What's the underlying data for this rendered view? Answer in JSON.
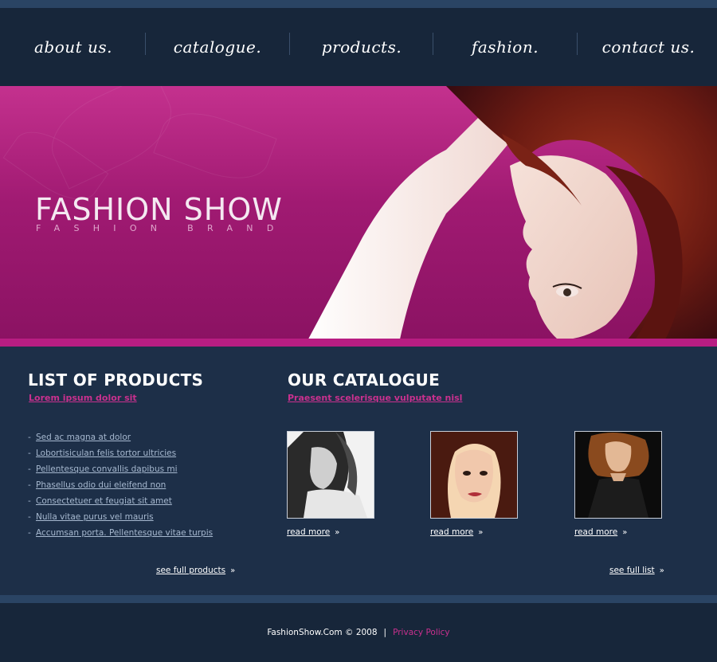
{
  "nav": {
    "items": [
      {
        "label": "about us."
      },
      {
        "label": "catalogue."
      },
      {
        "label": "products."
      },
      {
        "label": "fashion."
      },
      {
        "label": "contact us."
      }
    ]
  },
  "hero": {
    "title": "FASHION SHOW",
    "subtitle": "FASHION BRAND"
  },
  "products": {
    "heading": "LIST OF PRODUCTS",
    "subheading": "Lorem ipsum dolor sit",
    "items": [
      "Sed ac magna at dolor",
      "Lobortisiculan felis tortor ultricies",
      "Pellentesque convallis dapibus mi",
      "Phasellus odio dui eleifend non",
      "Consectetuer et feugiat sit amet",
      "Nulla vitae purus vel mauris",
      "Accumsan porta. Pellentesque vitae turpis"
    ],
    "see_full_label": "see full products"
  },
  "catalogue": {
    "heading": "OUR CATALOGUE",
    "subheading": "Praesent scelerisque vulputate nisl",
    "read_more_label": "read more",
    "see_full_label": "see full list"
  },
  "footer": {
    "copyright": "FashionShow.Com © 2008",
    "separator": "|",
    "privacy": "Privacy Policy"
  },
  "colors": {
    "background": "#1d2f48",
    "nav": "#17263a",
    "accent": "#c9308e",
    "hero": "#a01a72"
  }
}
